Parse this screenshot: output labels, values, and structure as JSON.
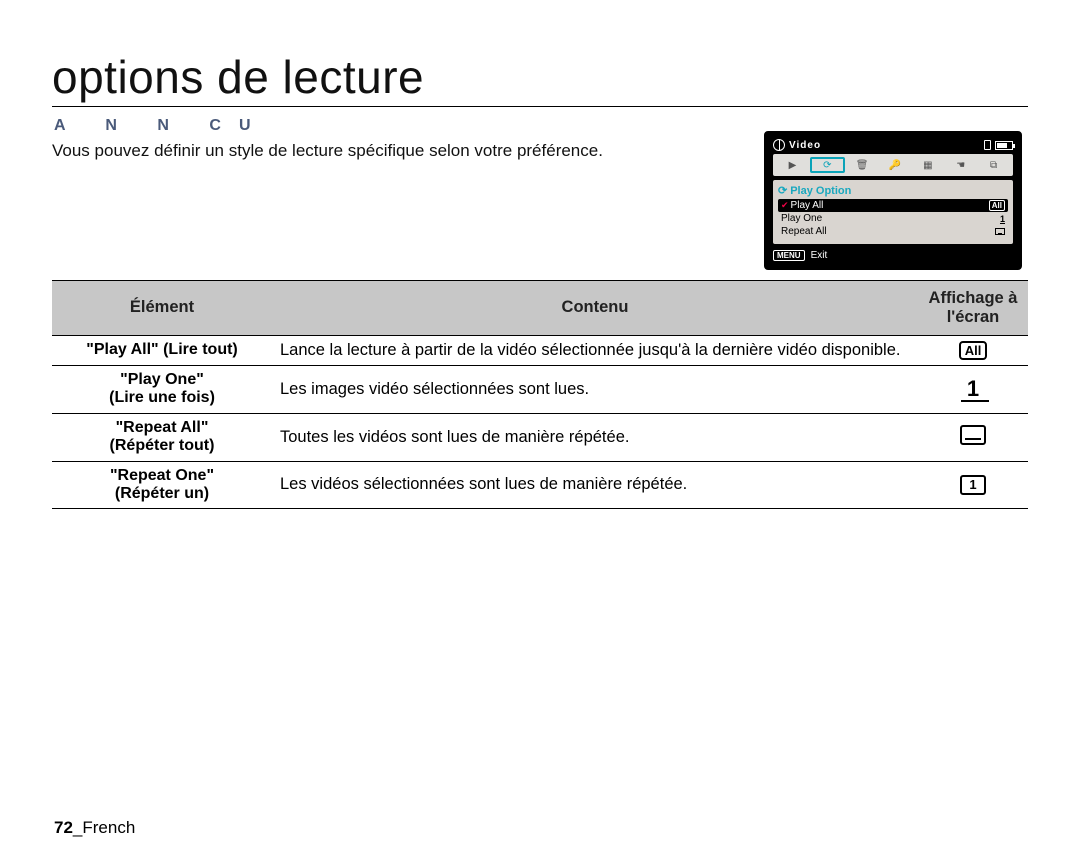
{
  "title": "options de lecture",
  "kicker": "A   N   N  CU",
  "intro": "Vous pouvez définir un style de lecture spécifique selon votre préférence.",
  "device": {
    "top_label": "Video",
    "menu_title": "Play Option",
    "items": [
      {
        "label": "Play All",
        "badge": "All",
        "selected": true
      },
      {
        "label": "Play One",
        "badge": "1",
        "selected": false
      },
      {
        "label": "Repeat All",
        "badge": "rep",
        "selected": false
      }
    ],
    "menu_key": "MENU",
    "exit_label": "Exit"
  },
  "headers": {
    "element": "Élément",
    "content": "Contenu",
    "display": "Afﬁchage à l'écran"
  },
  "rows": [
    {
      "label_en": "Play All",
      "label_fr": "(Lire tout)",
      "content": "Lance la lecture à partir de la vidéo sélectionnée jusqu'à la dernière vidéo disponible.",
      "icon": "all"
    },
    {
      "label_en": "Play One",
      "label_fr": "(Lire une fois)",
      "content": "Les images vidéo sélectionnées sont lues.",
      "icon": "one"
    },
    {
      "label_en": "Repeat All",
      "label_fr": "(Répéter tout)",
      "content": "Toutes les vidéos sont lues de manière répétée.",
      "icon": "repall"
    },
    {
      "label_en": "Repeat One",
      "label_fr": "(Répéter un)",
      "content": "Les vidéos sélectionnées sont lues de manière répétée.",
      "icon": "repone"
    }
  ],
  "footer": {
    "page": "72",
    "sep": "_",
    "locale": "French"
  }
}
